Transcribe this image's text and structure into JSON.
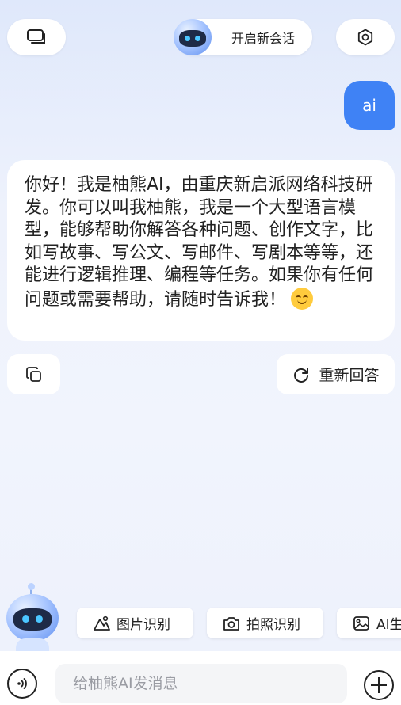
{
  "header": {
    "new_chat_label": "开启新会话",
    "history_icon": "chat-history-icon",
    "settings_icon": "settings-icon",
    "mascot": "robot-mascot"
  },
  "conversation": {
    "user_message": "ai",
    "bot_message": "你好！我是柚熊AI，由重庆新启派网络科技研发。你可以叫我柚熊，我是一个大型语言模型，能够帮助你解答各种问题、创作文字，比如写故事、写公文、写邮件、写剧本等等，还能进行逻辑推理、编程等任务。如果你有任何问题或需要帮助，请随时告诉我！",
    "bot_emoji": "smiling-face"
  },
  "actions": {
    "copy_icon": "copy-icon",
    "regenerate_label": "重新回答",
    "regenerate_icon": "refresh-icon"
  },
  "quick_chips": [
    {
      "label": "图片识别",
      "icon": "image-recognition-icon"
    },
    {
      "label": "拍照识别",
      "icon": "camera-icon"
    },
    {
      "label": "AI生",
      "icon": "ai-image-icon"
    }
  ],
  "composer": {
    "placeholder": "给柚熊AI发消息",
    "voice_icon": "voice-icon",
    "plus_icon": "plus-icon"
  },
  "colors": {
    "accent": "#3f82f5",
    "bubble_bg": "#ffffff",
    "page_bg": "#eef2fc"
  }
}
